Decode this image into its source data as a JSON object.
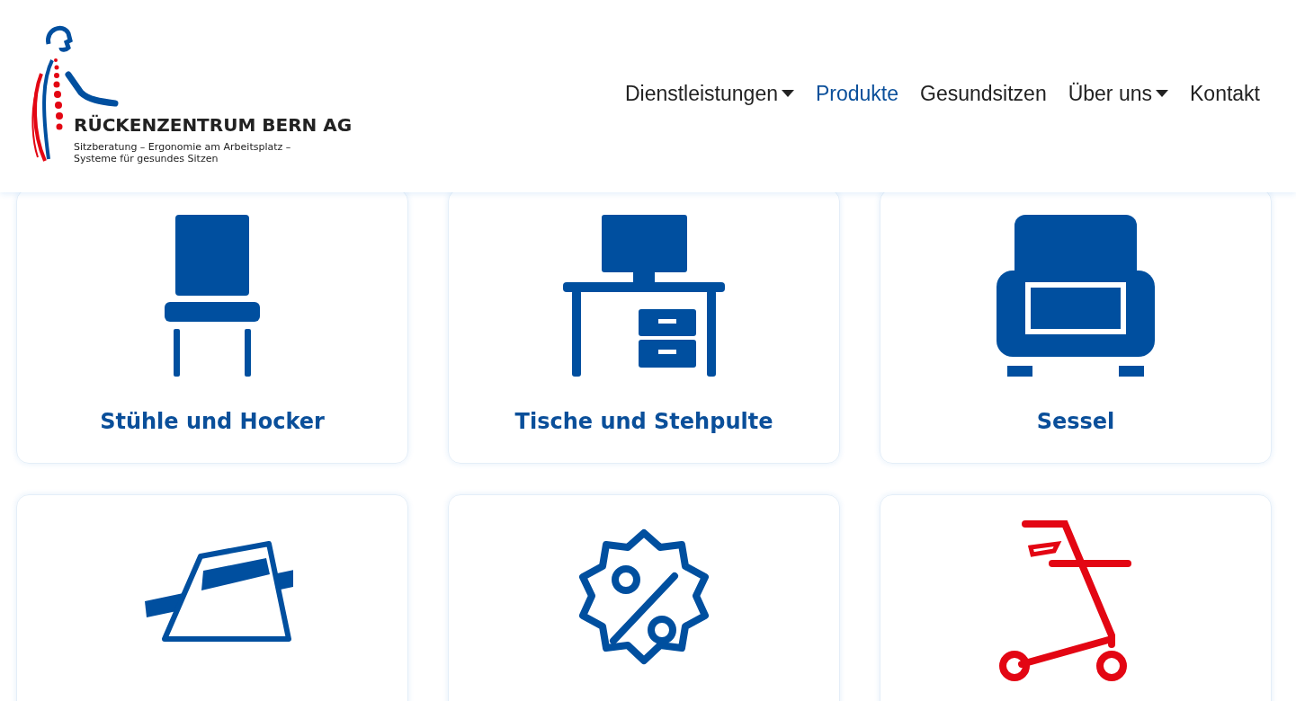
{
  "brand": {
    "name": "RÜCKENZENTRUM BERN AG",
    "tagline": [
      "Sitzberatung – Ergonomie am Arbeitsplatz –",
      "Systeme für gesundes Sitzen"
    ]
  },
  "nav": [
    {
      "label": "Dienstleistungen",
      "selected": false,
      "dropdown": true
    },
    {
      "label": "Produkte",
      "selected": true,
      "dropdown": false
    },
    {
      "label": "Gesundsitzen",
      "selected": false,
      "dropdown": false
    },
    {
      "label": "Über uns",
      "selected": false,
      "dropdown": true
    },
    {
      "label": "Kontakt",
      "selected": false,
      "dropdown": false
    }
  ],
  "cards": [
    {
      "kind": "chair",
      "title": "Stühle und Hocker",
      "color": "#004f9f"
    },
    {
      "kind": "desk",
      "title": "Tische und Stehpulte",
      "color": "#004f9f"
    },
    {
      "kind": "armchair",
      "title": "Sessel",
      "color": "#004f9f"
    },
    {
      "kind": "cushion",
      "color": "#004f9f"
    },
    {
      "kind": "discount",
      "color": "#004f9f"
    },
    {
      "kind": "rollator",
      "color": "#e30613"
    }
  ]
}
